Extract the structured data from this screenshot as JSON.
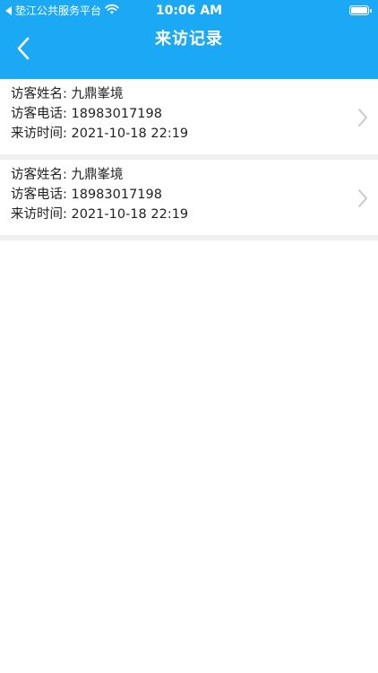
{
  "status_bar": {
    "carrier": "垫江公共服务平台",
    "time": "10:06 AM"
  },
  "nav": {
    "title": "来访记录"
  },
  "visits": [
    {
      "name": "访客姓名: 九鼎峯境",
      "phone": "访客电话: 18983017198",
      "time": "来访时间: 2021-10-18 22:19"
    },
    {
      "name": "访客姓名: 九鼎峯境",
      "phone": "访客电话: 18983017198",
      "time": "来访时间: 2021-10-18 22:19"
    }
  ],
  "colors": {
    "header": "#1ba9f6",
    "divider": "#f0f0f0"
  },
  "icons": {
    "back": "chevron-left-icon",
    "wifi": "wifi-icon",
    "battery": "battery-icon",
    "row": "chevron-right-icon"
  }
}
